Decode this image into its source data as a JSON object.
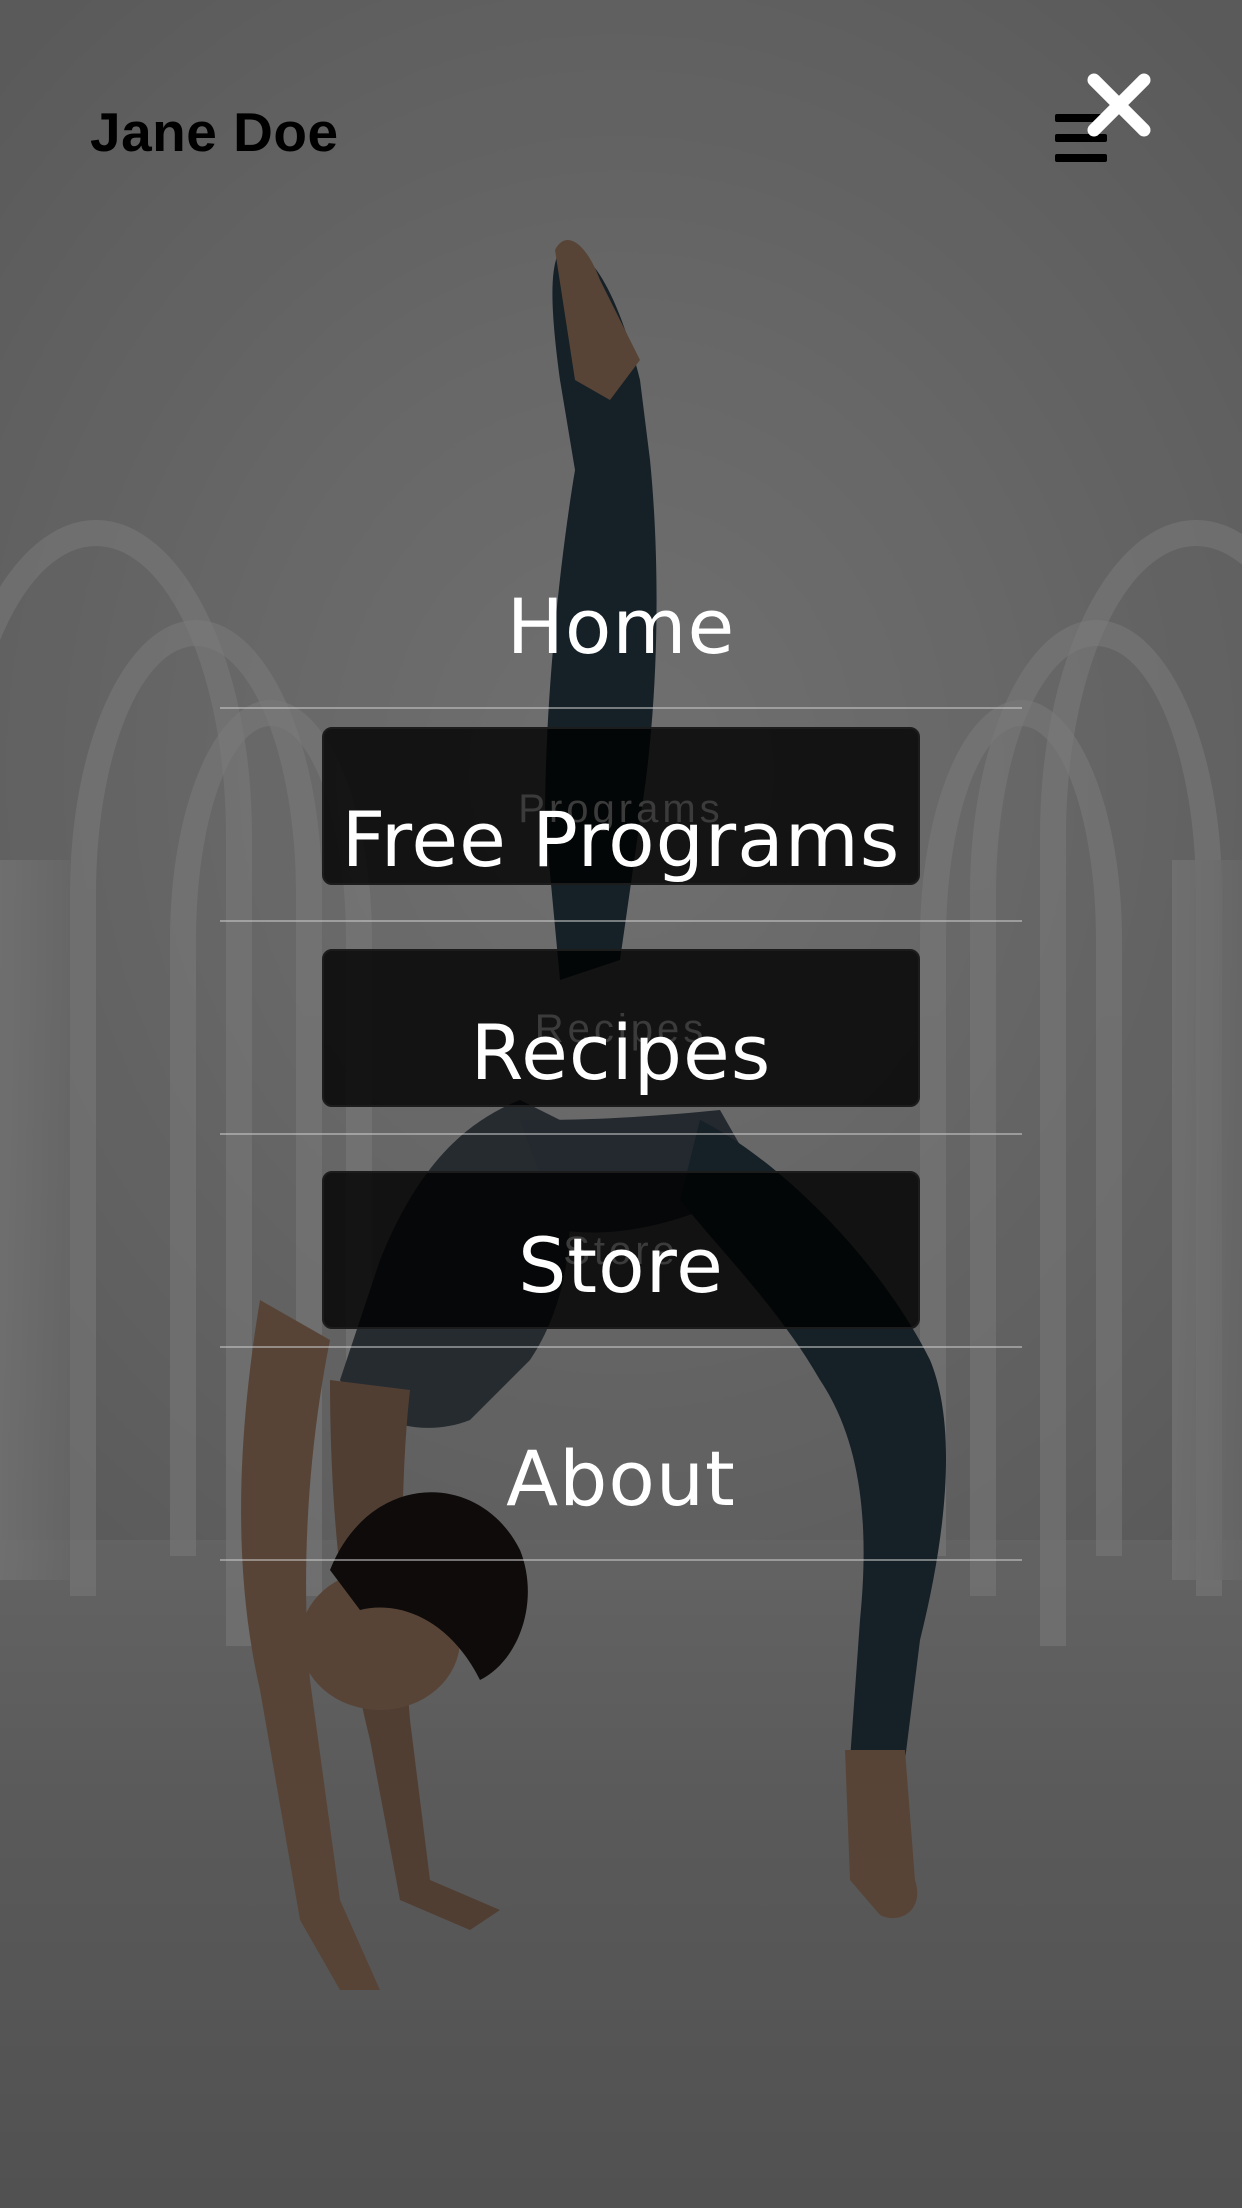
{
  "header": {
    "brand": "Jane Doe",
    "menu_icon": "hamburger-icon",
    "close_icon": "close-icon"
  },
  "page": {
    "buttons": [
      {
        "label": "Programs"
      },
      {
        "label": "Recipes"
      },
      {
        "label": "Store"
      }
    ]
  },
  "menu": {
    "items": [
      {
        "label": "Home"
      },
      {
        "label": "Free Programs"
      },
      {
        "label": "Recipes"
      },
      {
        "label": "Store"
      },
      {
        "label": "About"
      }
    ]
  },
  "colors": {
    "overlay": "#000000",
    "menu_text": "#ffffff",
    "brand_text": "#000000"
  }
}
